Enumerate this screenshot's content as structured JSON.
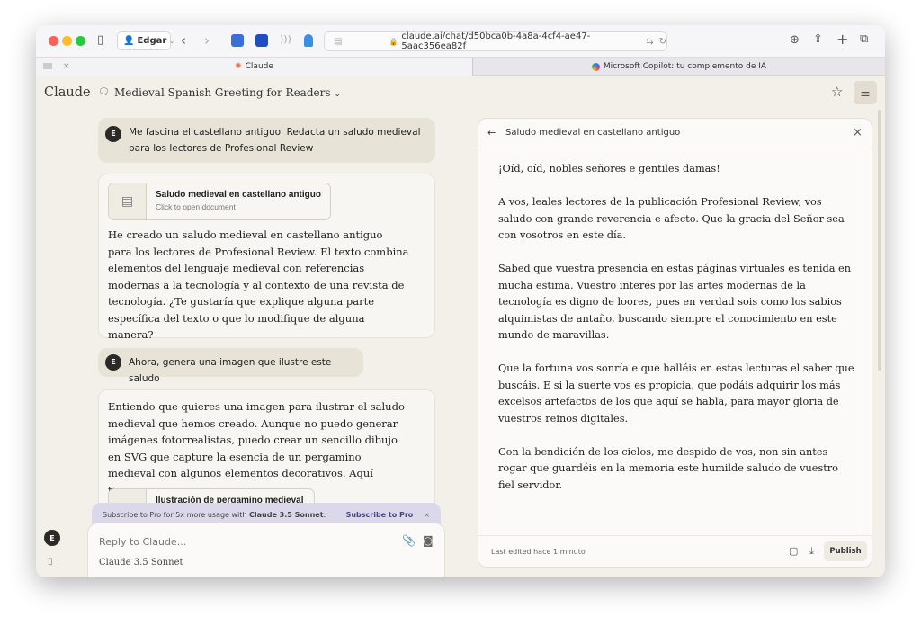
{
  "browser": {
    "profile": "Edgar",
    "url": "claude.ai/chat/d50bca0b-4a8a-4cf4-ae47-5aac356ea82f",
    "tabs": [
      {
        "label": "Claude"
      },
      {
        "label": "Microsoft Copilot: tu complemento de IA"
      }
    ]
  },
  "header": {
    "logo": "Claude",
    "chat_title": "Medieval Spanish Greeting for Readers"
  },
  "messages": [
    {
      "role": "user",
      "avatar": "E",
      "text": "Me fascina el castellano antiguo. Redacta un saludo medieval para los lectores de Profesional Review"
    },
    {
      "role": "assistant",
      "card": {
        "title": "Saludo medieval en castellano antiguo",
        "subtitle": "Click to open document"
      },
      "text": "He creado un saludo medieval en castellano antiguo para los lectores de Profesional Review. El texto combina elementos del lenguaje medieval con referencias modernas a la tecnología y al contexto de una revista de tecnología. ¿Te gustaría que explique alguna parte específica del texto o que lo modifique de alguna manera?"
    },
    {
      "role": "user",
      "avatar": "E",
      "text": "Ahora, genera una imagen que ilustre este saludo"
    },
    {
      "role": "assistant",
      "text": "Entiendo que quieres una imagen para ilustrar el saludo medieval que hemos creado. Aunque no puedo generar imágenes fotorrealistas, puedo crear un sencillo dibujo en SVG que capture la esencia de un pergamino medieval con algunos elementos decorativos. Aquí tienes:",
      "card": {
        "title": "Ilustración de pergamino medieval"
      }
    }
  ],
  "banner": {
    "text": "Subscribe to Pro for 5x more usage with ",
    "bold": "Claude 3.5 Sonnet",
    "end": ".",
    "action": "Subscribe to Pro"
  },
  "composer": {
    "placeholder": "Reply to Claude...",
    "model": "Claude 3.5 Sonnet"
  },
  "sidebar": {
    "avatar": "E"
  },
  "artifact": {
    "title": "Saludo medieval en castellano antiguo",
    "paragraphs": [
      "¡Oíd, oíd, nobles señores e gentiles damas!",
      "A vos, leales lectores de la publicación Profesional Review, vos saludo con grande reverencia e afecto. Que la gracia del Señor sea con vosotros en este día.",
      "Sabed que vuestra presencia en estas páginas virtuales es tenida en mucha estima. Vuestro interés por las artes modernas de la tecnología es digno de loores, pues en verdad sois como los sabios alquimistas de antaño, buscando siempre el conocimiento en este mundo de maravillas.",
      "Que la fortuna vos sonría e que halléis en estas lecturas el saber que buscáis. E si la suerte vos es propicia, que podáis adquirir los más excelsos artefactos de los que aquí se habla, para mayor gloria de vuestros reinos digitales.",
      "Con la bendición de los cielos, me despido de vos, non sin antes rogar que guardéis en la memoria este humilde saludo de vuestro fiel servidor."
    ],
    "last_edited": "Last edited hace 1 minuto",
    "publish": "Publish"
  }
}
